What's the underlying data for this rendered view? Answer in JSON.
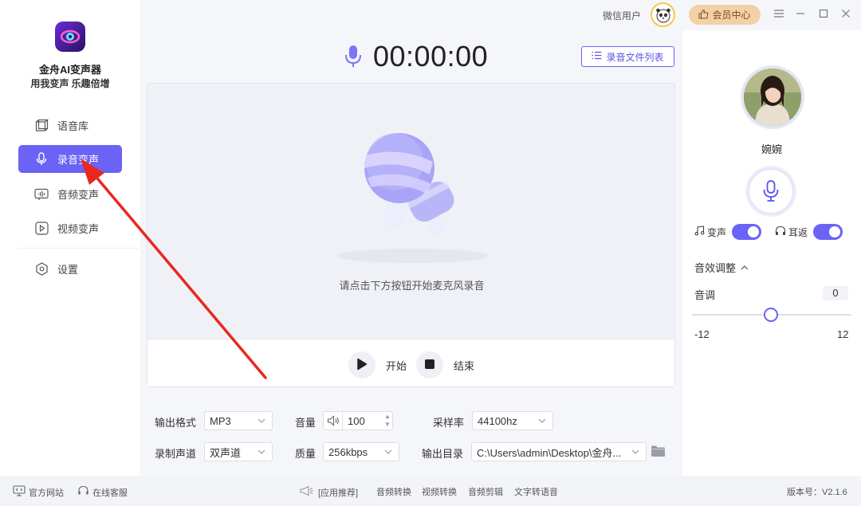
{
  "app": {
    "name": "金舟AI变声器",
    "slogan": "用我变声 乐趣倍增"
  },
  "sidebar": {
    "items": [
      {
        "label": "语音库",
        "icon": "cube-icon"
      },
      {
        "label": "录音变声",
        "icon": "mic-icon",
        "active": true
      },
      {
        "label": "音频变声",
        "icon": "audio-wave-icon"
      },
      {
        "label": "视频变声",
        "icon": "video-play-icon"
      }
    ],
    "settings_label": "设置"
  },
  "topbar": {
    "user": "微信用户",
    "vip_label": "会员中心"
  },
  "recorder": {
    "timer": "00:00:00",
    "list_button": "录音文件列表",
    "hint": "请点击下方按钮开始麦克风录音",
    "start_label": "开始",
    "stop_label": "结束"
  },
  "settings": {
    "format_label": "输出格式",
    "format_value": "MP3",
    "volume_label": "音量",
    "volume_value": "100",
    "samplerate_label": "采样率",
    "samplerate_value": "44100hz",
    "channel_label": "录制声道",
    "channel_value": "双声道",
    "quality_label": "质量",
    "quality_value": "256kbps",
    "outdir_label": "输出目录",
    "outdir_value": "C:\\Users\\admin\\Desktop\\金舟..."
  },
  "voice_panel": {
    "voice_name": "婉婉",
    "change_label": "变声",
    "change_on": true,
    "monitor_label": "耳返",
    "monitor_on": true,
    "fx_title": "音效调整",
    "pitch_label": "音调",
    "pitch_value": "0",
    "pitch_min": "-12",
    "pitch_max": "12"
  },
  "statusbar": {
    "website": "官方网站",
    "support": "在线客服",
    "recommend": "[应用推荐]",
    "links": [
      "音频转换",
      "视频转换",
      "音频剪辑",
      "文字转语音"
    ],
    "version": "版本号：V2.1.6"
  },
  "colors": {
    "accent": "#6a63f6",
    "vip": "#f3d1a6",
    "annotation_arrow": "#e8281f"
  }
}
